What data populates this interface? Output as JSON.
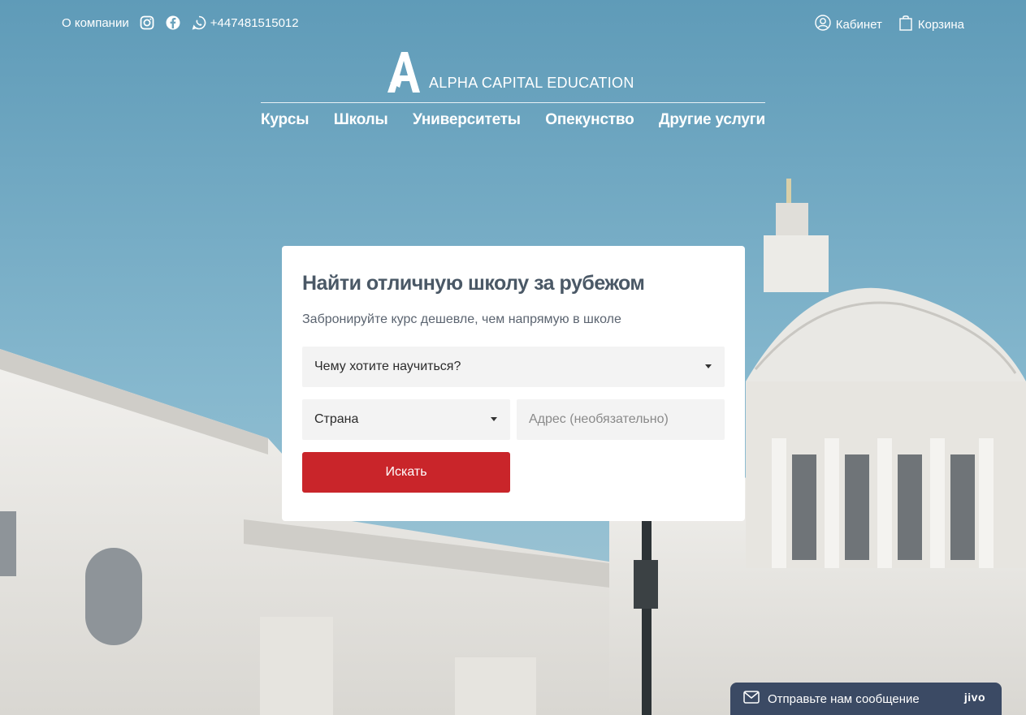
{
  "topbar": {
    "about": "О компании",
    "instagram_icon": "instagram-icon",
    "facebook_icon": "facebook-icon",
    "whatsapp_icon": "whatsapp-icon",
    "phone": "+447481515012",
    "cabinet": "Кабинет",
    "cart": "Корзина"
  },
  "logo": {
    "brand": "ALPHA CAPITAL EDUCATION"
  },
  "nav": {
    "items": [
      "Курсы",
      "Школы",
      "Университеты",
      "Опекунство",
      "Другие услуги"
    ]
  },
  "search": {
    "title": "Найти отличную школу за рубежом",
    "subtitle": "Забронируйте курс дешевле, чем напрямую в школе",
    "learn_select": "Чему хотите научиться?",
    "country_select": "Страна",
    "address_placeholder": "Адрес (необязательно)",
    "submit": "Искать"
  },
  "chat": {
    "label": "Отправьте нам сообщение",
    "brand": "jivo"
  },
  "colors": {
    "accent": "#c9252a",
    "title": "#4a5866",
    "chat": "#3b4a64",
    "sky": "#6aa3bd"
  }
}
